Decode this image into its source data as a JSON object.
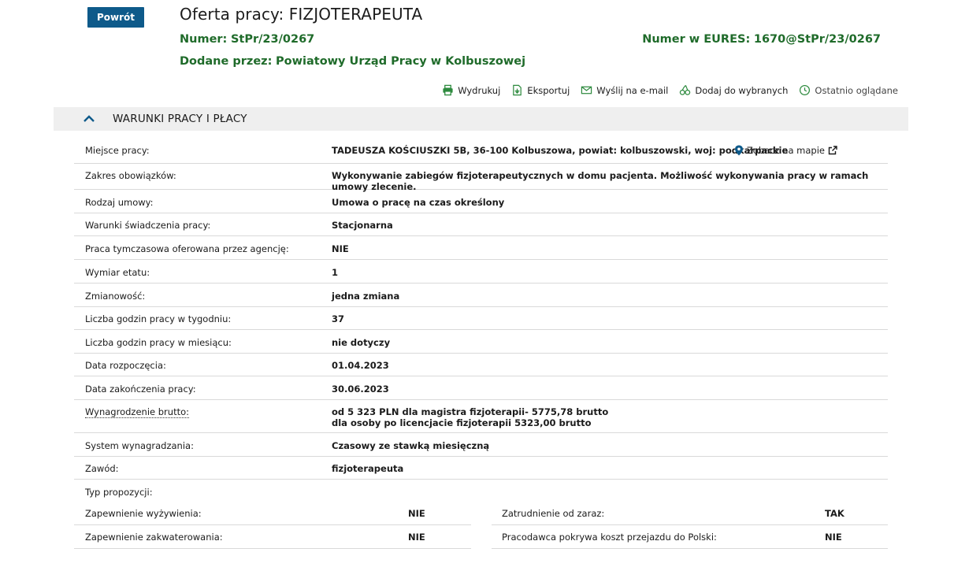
{
  "header": {
    "back_label": "Powrót",
    "title": "Oferta pracy: FIZJOTERAPEUTA",
    "number_label": "Numer:",
    "number_value": "StPr/23/0267",
    "eures_label": "Numer w EURES:",
    "eures_value": "1670@StPr/23/0267",
    "added_label": "Dodane przez:",
    "added_value": "Powiatowy Urząd Pracy w Kolbuszowej"
  },
  "toolbar": {
    "print": "Wydrukuj",
    "export": "Eksportuj",
    "email": "Wyślij na e-mail",
    "favorite": "Dodaj do wybranych",
    "recent": "Ostatnio oglądane"
  },
  "section": {
    "title": "WARUNKI PRACY I PŁACY",
    "map_link": "Zobacz na mapie",
    "rows": {
      "place": {
        "label": "Miejsce pracy:",
        "value": "TADEUSZA KOŚCIUSZKI 5B, 36-100 Kolbuszowa, powiat: kolbuszowski, woj: podkarpackie"
      },
      "duties": {
        "label": "Zakres obowiązków:",
        "value": "Wykonywanie zabiegów fizjoterapeutycznych w domu pacjenta. Możliwość wykonywania pracy w ramach umowy zlecenie."
      },
      "contract": {
        "label": "Rodzaj umowy:",
        "value": "Umowa o pracę na czas określony"
      },
      "conditions": {
        "label": "Warunki świadczenia pracy:",
        "value": "Stacjonarna"
      },
      "agency": {
        "label": "Praca tymczasowa oferowana przez agencję:",
        "value": "NIE"
      },
      "fte": {
        "label": "Wymiar etatu:",
        "value": "1"
      },
      "shifts": {
        "label": "Zmianowość:",
        "value": "jedna zmiana"
      },
      "hours_week": {
        "label": "Liczba godzin pracy w tygodniu:",
        "value": "37"
      },
      "hours_month": {
        "label": "Liczba godzin pracy w miesiącu:",
        "value": "nie dotyczy"
      },
      "start": {
        "label": "Data rozpoczęcia:",
        "value": "01.04.2023"
      },
      "end": {
        "label": "Data zakończenia pracy:",
        "value": "30.06.2023"
      },
      "salary": {
        "label": "Wynagrodzenie brutto:",
        "value_line1": "od 5 323 PLN dla magistra fizjoterapii- 5775,78 brutto",
        "value_line2": "dla osoby po licencjacie fizjoterapii 5323,00 brutto"
      },
      "pay_system": {
        "label": "System wynagradzania:",
        "value": "Czasowy ze stawką miesięczną"
      },
      "profession": {
        "label": "Zawód:",
        "value": "fizjoterapeuta"
      },
      "offer_type": {
        "label": "Typ propozycji:"
      }
    },
    "extras": {
      "left": [
        {
          "label": "Zapewnienie wyżywienia:",
          "value": "NIE"
        },
        {
          "label": "Zapewnienie zakwaterowania:",
          "value": "NIE"
        }
      ],
      "right": [
        {
          "label": "Zatrudnienie od zaraz:",
          "value": "TAK"
        },
        {
          "label": "Pracodawca pokrywa koszt przejazdu do Polski:",
          "value": "NIE"
        }
      ]
    }
  },
  "colors": {
    "primary_blue": "#0e5a8a",
    "green_text": "#1f6b2a",
    "section_bg": "#efefef",
    "icon_green": "#2d8a3e"
  }
}
